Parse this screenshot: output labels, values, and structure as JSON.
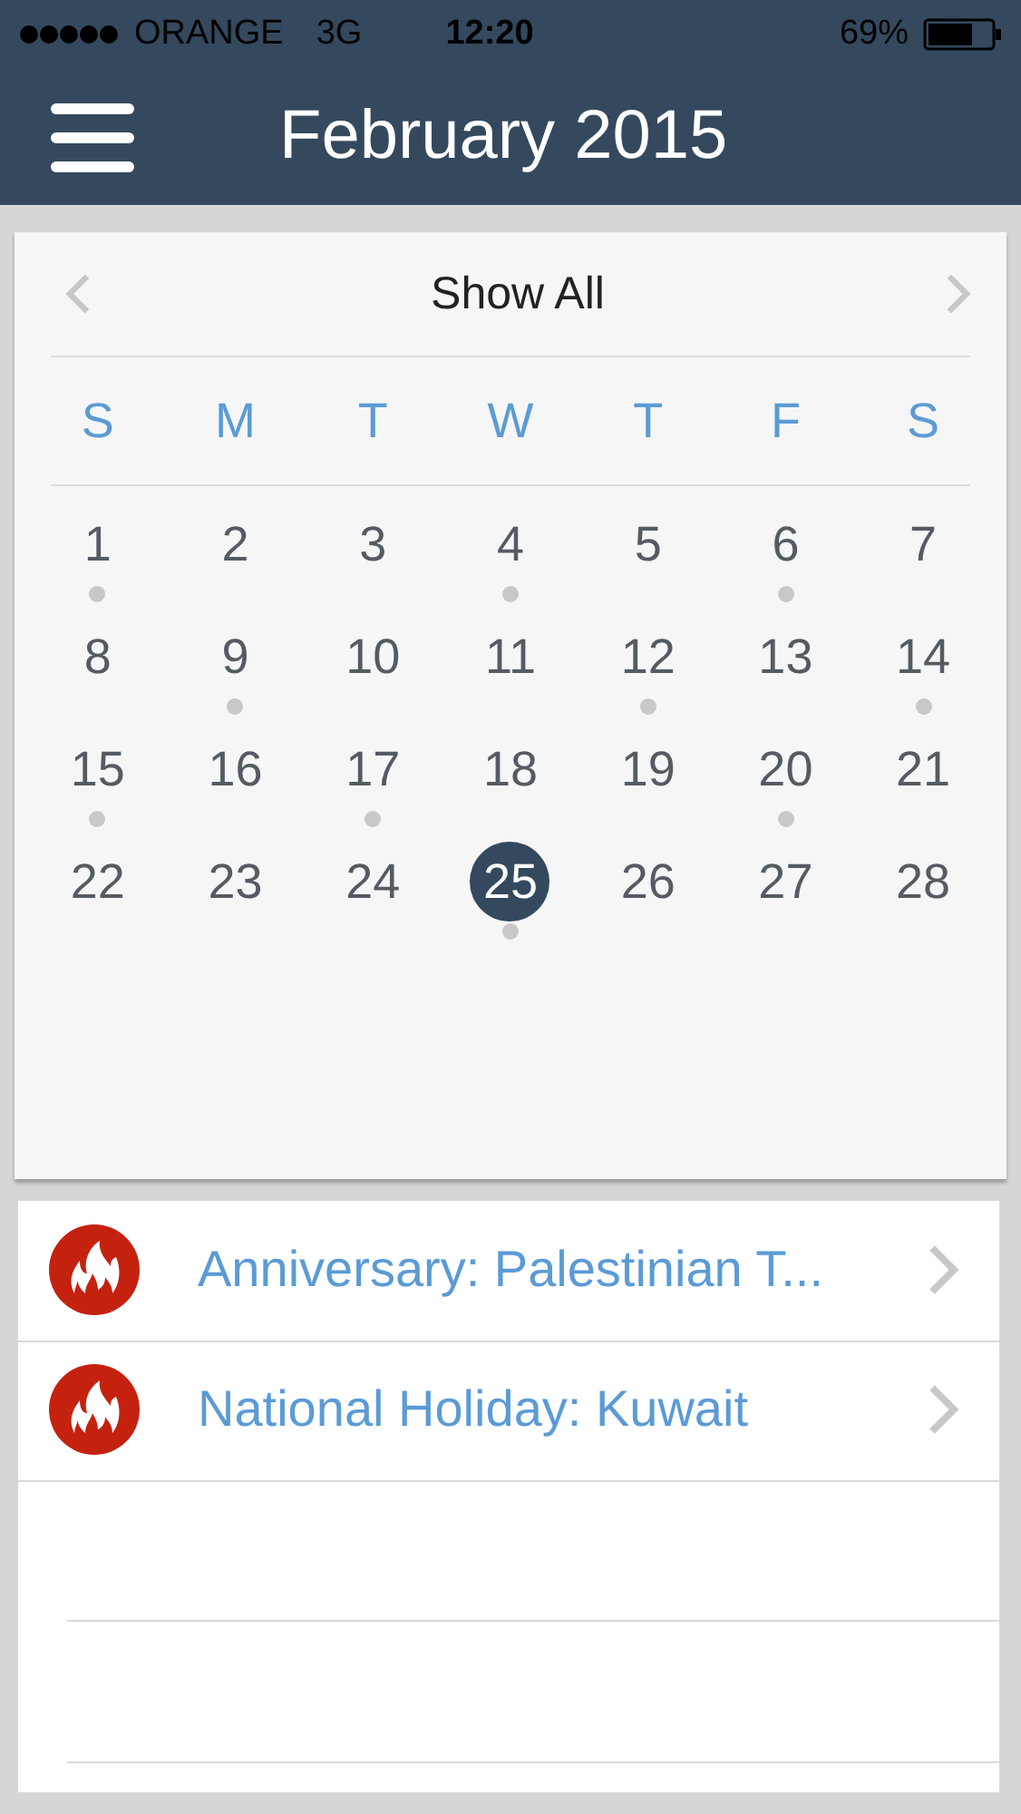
{
  "status_bar": {
    "carrier": "ORANGE",
    "network": "3G",
    "time": "12:20",
    "battery": "69%"
  },
  "nav": {
    "title": "February 2015"
  },
  "calendar": {
    "filter": "Show All",
    "weekdays": [
      "S",
      "M",
      "T",
      "W",
      "T",
      "F",
      "S"
    ],
    "days": [
      {
        "label": "1",
        "has_event": true,
        "selected": false
      },
      {
        "label": "2",
        "has_event": false,
        "selected": false
      },
      {
        "label": "3",
        "has_event": false,
        "selected": false
      },
      {
        "label": "4",
        "has_event": true,
        "selected": false
      },
      {
        "label": "5",
        "has_event": false,
        "selected": false
      },
      {
        "label": "6",
        "has_event": true,
        "selected": false
      },
      {
        "label": "7",
        "has_event": false,
        "selected": false
      },
      {
        "label": "8",
        "has_event": false,
        "selected": false
      },
      {
        "label": "9",
        "has_event": true,
        "selected": false
      },
      {
        "label": "10",
        "has_event": false,
        "selected": false
      },
      {
        "label": "11",
        "has_event": false,
        "selected": false
      },
      {
        "label": "12",
        "has_event": true,
        "selected": false
      },
      {
        "label": "13",
        "has_event": false,
        "selected": false
      },
      {
        "label": "14",
        "has_event": true,
        "selected": false
      },
      {
        "label": "15",
        "has_event": true,
        "selected": false
      },
      {
        "label": "16",
        "has_event": false,
        "selected": false
      },
      {
        "label": "17",
        "has_event": true,
        "selected": false
      },
      {
        "label": "18",
        "has_event": false,
        "selected": false
      },
      {
        "label": "19",
        "has_event": false,
        "selected": false
      },
      {
        "label": "20",
        "has_event": true,
        "selected": false
      },
      {
        "label": "21",
        "has_event": false,
        "selected": false
      },
      {
        "label": "22",
        "has_event": false,
        "selected": false
      },
      {
        "label": "23",
        "has_event": false,
        "selected": false
      },
      {
        "label": "24",
        "has_event": false,
        "selected": false
      },
      {
        "label": "25",
        "has_event": true,
        "selected": true
      },
      {
        "label": "26",
        "has_event": false,
        "selected": false
      },
      {
        "label": "27",
        "has_event": false,
        "selected": false
      },
      {
        "label": "28",
        "has_event": false,
        "selected": false
      }
    ]
  },
  "events": [
    {
      "title": "Anniversary: Palestinian T..."
    },
    {
      "title": "National Holiday: Kuwait"
    }
  ]
}
